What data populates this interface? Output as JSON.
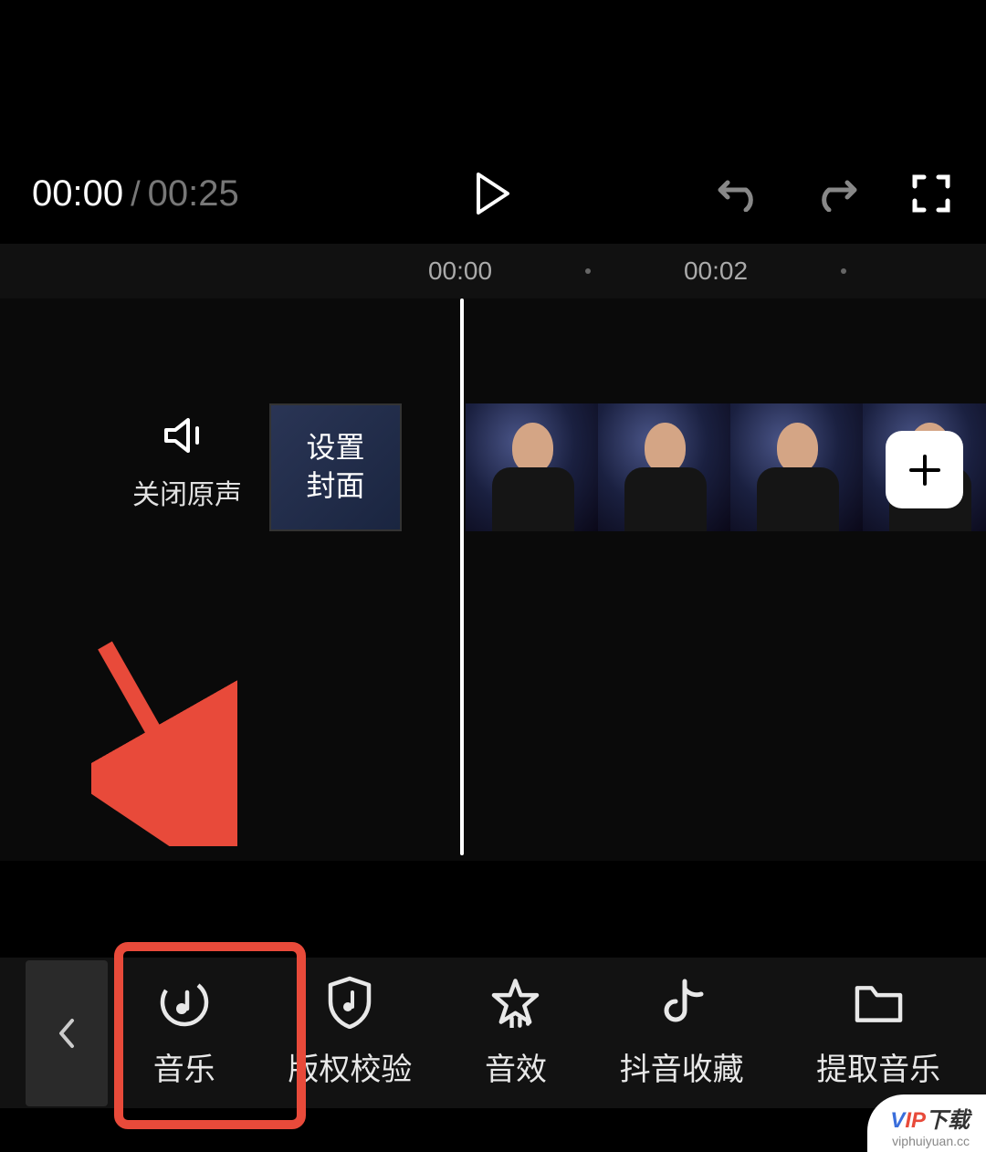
{
  "playback": {
    "current_time": "00:00",
    "total_time": "00:25"
  },
  "ruler": {
    "mark1": "00:00",
    "mark2": "00:02"
  },
  "mute": {
    "label": "关闭原声"
  },
  "cover": {
    "line1": "设置",
    "line2": "封面"
  },
  "toolbar": {
    "items": [
      {
        "label": "音乐"
      },
      {
        "label": "版权校验"
      },
      {
        "label": "音效"
      },
      {
        "label": "抖音收藏"
      },
      {
        "label": "提取音乐"
      }
    ]
  },
  "watermark": {
    "sub": "viphuiyuan.cc"
  }
}
